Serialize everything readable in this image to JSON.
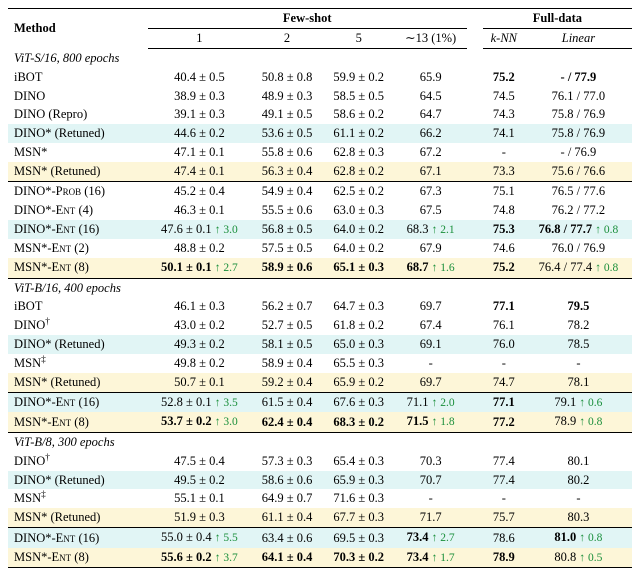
{
  "header": {
    "method": "Method",
    "fewshot": "Few-shot",
    "fulldata": "Full-data",
    "shots": [
      "1",
      "2",
      "5",
      "∼13 (1%)"
    ],
    "full_cols": [
      "k-NN",
      "Linear"
    ]
  },
  "sections": [
    {
      "title": "ViT-S/16, 800 epochs",
      "groups": [
        [
          {
            "m": "iBOT",
            "hl": "",
            "sh": [
              "40.4 ± 0.5",
              "50.8 ± 0.8",
              "59.9 ± 0.2",
              "65.9"
            ],
            "knn": "75.2",
            "knn_b": true,
            "lin": "-  / 77.9",
            "lin_b": true
          },
          {
            "m": "DINO",
            "hl": "",
            "sh": [
              "38.9 ± 0.3",
              "48.9 ± 0.3",
              "58.5 ± 0.5",
              "64.5"
            ],
            "knn": "74.5",
            "lin": "76.1 / 77.0"
          },
          {
            "m": "DINO (Repro)",
            "hl": "",
            "sh": [
              "39.1 ± 0.3",
              "49.1 ± 0.5",
              "58.6 ± 0.2",
              "64.7"
            ],
            "knn": "74.3",
            "lin": "75.8 / 76.9"
          },
          {
            "m": "DINO* (Retuned)",
            "hl": "cyan",
            "sh": [
              "44.6 ± 0.2",
              "53.6 ± 0.5",
              "61.1 ± 0.2",
              "66.2"
            ],
            "knn": "74.1",
            "lin": "75.8 / 76.9"
          },
          {
            "m": "MSN*",
            "hl": "",
            "sh": [
              "47.1 ± 0.1",
              "55.8 ± 0.6",
              "62.8 ± 0.3",
              "67.2"
            ],
            "knn": "-",
            "lin": "-  / 76.9"
          },
          {
            "m": "MSN* (Retuned)",
            "hl": "yellow",
            "sh": [
              "47.4 ± 0.1",
              "56.3 ± 0.4",
              "62.8 ± 0.2",
              "67.1"
            ],
            "knn": "73.3",
            "lin": "75.6 / 76.6"
          }
        ],
        [
          {
            "m": "DINO*-PROB (16)",
            "sc": true,
            "hl": "",
            "sh": [
              "45.2 ± 0.4",
              "54.9 ± 0.4",
              "62.5 ± 0.2",
              "67.3"
            ],
            "knn": "75.1",
            "lin": "76.5 / 77.6"
          },
          {
            "m": "DINO*-ENT (4)",
            "sc": true,
            "hl": "",
            "sh": [
              "46.3 ± 0.1",
              "55.5 ± 0.6",
              "63.0 ± 0.3",
              "67.5"
            ],
            "knn": "74.8",
            "lin": "76.2 / 77.2"
          },
          {
            "m": "DINO*-ENT (16)",
            "sc": true,
            "hl": "cyan",
            "sh": [
              "47.6 ± 0.1",
              "56.8 ± 0.5",
              "64.0 ± 0.2",
              "68.3"
            ],
            "d": [
              "↑ 3.0",
              "",
              "",
              "↑ 2.1"
            ],
            "knn": "75.3",
            "knn_b": true,
            "lin": "76.8 / 77.7",
            "lin_b": true,
            "lind": "↑ 0.8"
          },
          {
            "m": "MSN*-ENT (2)",
            "sc": true,
            "hl": "",
            "sh": [
              "48.8 ± 0.2",
              "57.5 ± 0.5",
              "64.0 ± 0.2",
              "67.9"
            ],
            "knn": "74.6",
            "lin": "76.0 / 76.9"
          },
          {
            "m": "MSN*-ENT (8)",
            "sc": true,
            "hl": "yellow",
            "sh": [
              "50.1 ± 0.1",
              "58.9 ± 0.6",
              "65.1 ± 0.3",
              "68.7"
            ],
            "sh_b": [
              true,
              true,
              true,
              true
            ],
            "d": [
              "↑ 2.7",
              "",
              "",
              "↑ 1.6"
            ],
            "knn": "75.2",
            "knn_b": true,
            "lin": "76.4 / 77.4",
            "lind": "↑ 0.8"
          }
        ]
      ]
    },
    {
      "title": "ViT-B/16, 400 epochs",
      "groups": [
        [
          {
            "m": "iBOT",
            "hl": "",
            "sh": [
              "46.1 ± 0.3",
              "56.2 ± 0.7",
              "64.7 ± 0.3",
              "69.7"
            ],
            "knn": "77.1",
            "knn_b": true,
            "lin": "79.5",
            "lin_b": true
          },
          {
            "m": "DINO†",
            "sup": true,
            "hl": "",
            "sh": [
              "43.0 ± 0.2",
              "52.7 ± 0.5",
              "61.8 ± 0.2",
              "67.4"
            ],
            "knn": "76.1",
            "lin": "78.2"
          },
          {
            "m": "DINO* (Retuned)",
            "hl": "cyan",
            "sh": [
              "49.3 ± 0.2",
              "58.1 ± 0.5",
              "65.0 ± 0.3",
              "69.1"
            ],
            "knn": "76.0",
            "lin": "78.5"
          },
          {
            "m": "MSN‡",
            "sup": true,
            "hl": "",
            "sh": [
              "49.8 ± 0.2",
              "58.9 ± 0.4",
              "65.5 ± 0.3",
              "-"
            ],
            "knn": "-",
            "lin": "-"
          },
          {
            "m": "MSN* (Retuned)",
            "hl": "yellow",
            "sh": [
              "50.7 ± 0.1",
              "59.2 ± 0.4",
              "65.9 ± 0.2",
              "69.7"
            ],
            "knn": "74.7",
            "lin": "78.1"
          }
        ],
        [
          {
            "m": "DINO*-ENT (16)",
            "sc": true,
            "hl": "cyan",
            "sh": [
              "52.8 ± 0.1",
              "61.5 ± 0.4",
              "67.6 ± 0.3",
              "71.1"
            ],
            "d": [
              "↑ 3.5",
              "",
              "",
              "↑ 2.0"
            ],
            "knn": "77.1",
            "knn_b": true,
            "lin": "79.1",
            "lind": "↑ 0.6"
          },
          {
            "m": "MSN*-ENT (8)",
            "sc": true,
            "hl": "yellow",
            "sh": [
              "53.7 ± 0.2",
              "62.4 ± 0.4",
              "68.3 ± 0.2",
              "71.5"
            ],
            "sh_b": [
              true,
              true,
              true,
              true
            ],
            "d": [
              "↑ 3.0",
              "",
              "",
              "↑ 1.8"
            ],
            "knn": "77.2",
            "knn_b": true,
            "lin": "78.9",
            "lind": "↑ 0.8"
          }
        ]
      ]
    },
    {
      "title": "ViT-B/8, 300 epochs",
      "groups": [
        [
          {
            "m": "DINO†",
            "sup": true,
            "hl": "",
            "sh": [
              "47.5 ± 0.4",
              "57.3 ± 0.3",
              "65.4 ± 0.3",
              "70.3"
            ],
            "knn": "77.4",
            "lin": "80.1"
          },
          {
            "m": "DINO* (Retuned)",
            "hl": "cyan",
            "sh": [
              "49.5 ± 0.2",
              "58.6 ± 0.6",
              "65.9 ± 0.3",
              "70.7"
            ],
            "knn": "77.4",
            "lin": "80.2"
          },
          {
            "m": "MSN‡",
            "sup": true,
            "hl": "",
            "sh": [
              "55.1 ± 0.1",
              "64.9 ± 0.7",
              "71.6 ± 0.3",
              "-"
            ],
            "knn": "-",
            "lin": "-"
          },
          {
            "m": "MSN* (Retuned)",
            "hl": "yellow",
            "sh": [
              "51.9 ± 0.3",
              "61.1 ± 0.4",
              "67.7 ± 0.3",
              "71.7"
            ],
            "knn": "75.7",
            "lin": "80.3"
          }
        ],
        [
          {
            "m": "DINO*-ENT (16)",
            "sc": true,
            "hl": "cyan",
            "sh": [
              "55.0 ± 0.4",
              "63.4 ± 0.6",
              "69.5 ± 0.3",
              "73.4"
            ],
            "sh_b": [
              false,
              false,
              false,
              true
            ],
            "d": [
              "↑ 5.5",
              "",
              "",
              "↑ 2.7"
            ],
            "knn": "78.6",
            "lin": "81.0",
            "lin_b": true,
            "lind": "↑ 0.8"
          },
          {
            "m": "MSN*-ENT (8)",
            "sc": true,
            "hl": "yellow",
            "sh": [
              "55.6 ± 0.2",
              "64.1 ± 0.4",
              "70.3 ± 0.2",
              "73.4"
            ],
            "sh_b": [
              true,
              true,
              true,
              true
            ],
            "d": [
              "↑ 3.7",
              "",
              "",
              "↑ 1.7"
            ],
            "knn": "78.9",
            "knn_b": true,
            "lin": "80.8",
            "lind": "↑ 0.5"
          }
        ]
      ]
    }
  ]
}
